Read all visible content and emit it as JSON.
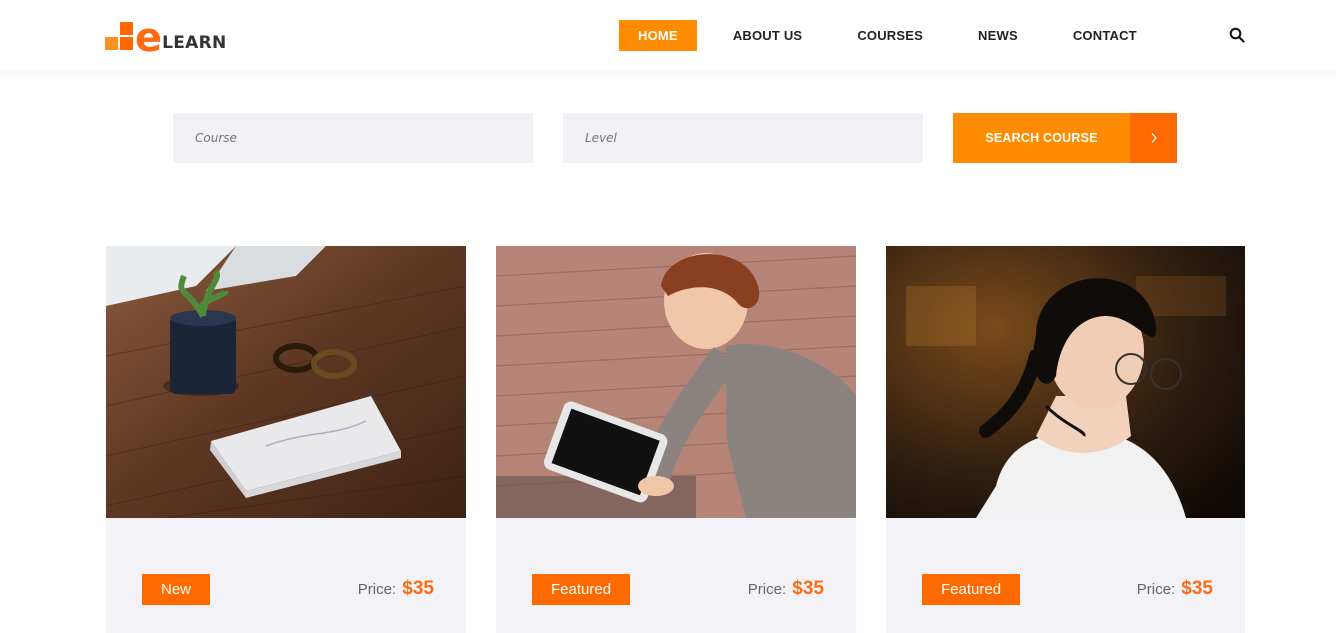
{
  "brand": {
    "logo_letter": "e",
    "logo_text": "LEARN"
  },
  "nav": {
    "items": [
      "HOME",
      "ABOUT US",
      "COURSES",
      "NEWS",
      "CONTACT"
    ],
    "active": "HOME",
    "search_icon": "magnifier"
  },
  "search": {
    "course_placeholder": "Course",
    "level_placeholder": "Level",
    "button_label": "SEARCH COURSE",
    "button_arrow": "›"
  },
  "courses": [
    {
      "badge": "New",
      "price_label": "Price:",
      "price": "$35",
      "image": "desk-with-book-plant-glasses"
    },
    {
      "badge": "Featured",
      "price_label": "Price:",
      "price": "$35",
      "image": "woman-reading-tablet"
    },
    {
      "badge": "Featured",
      "price_label": "Price:",
      "price": "$35",
      "image": "woman-with-glasses-reading"
    }
  ],
  "colors": {
    "accent": "#ff8c00",
    "accent_dark": "#ff6a00",
    "card_bg": "#f2f2f7",
    "field_bg": "#f1f1f6"
  }
}
